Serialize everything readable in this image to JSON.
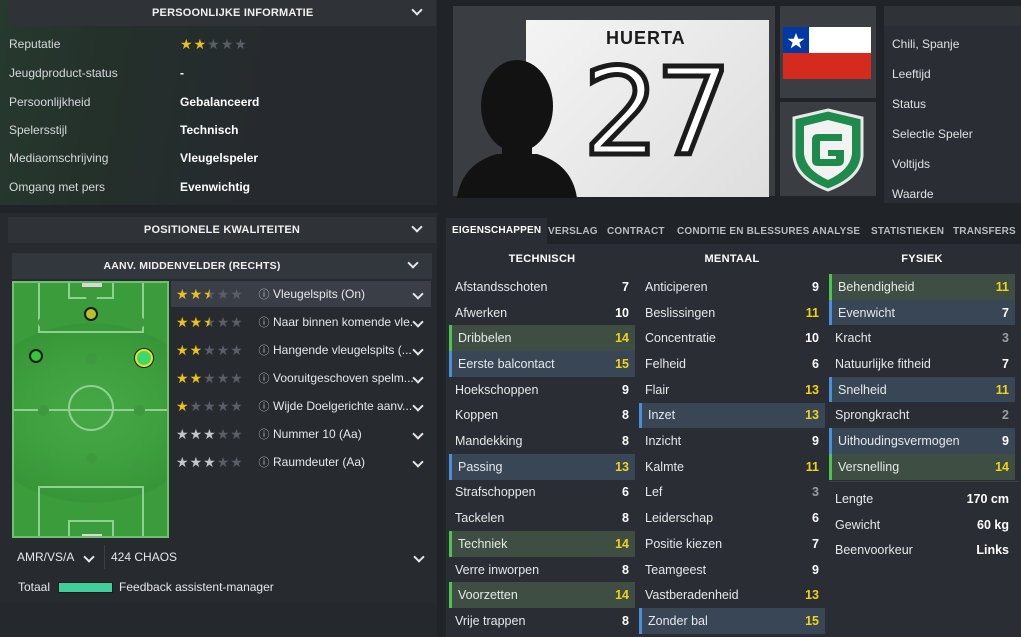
{
  "personal": {
    "header": "Persoonlijke informatie",
    "rows": [
      {
        "label": "Reputatie",
        "value": "",
        "stars": 2
      },
      {
        "label": "Jeugdproduct-status",
        "value": "-"
      },
      {
        "label": "Persoonlijkheid",
        "value": "Gebalanceerd"
      },
      {
        "label": "Spelersstijl",
        "value": "Technisch"
      },
      {
        "label": "Mediaomschrijving",
        "value": "Vleugelspeler"
      },
      {
        "label": "Omgang met pers",
        "value": "Evenwichtig"
      }
    ]
  },
  "positional": {
    "header": "Positionele kwaliteiten",
    "position_dropdown": "AANV. MIDDENVELDER (RECHTS)",
    "roles": [
      {
        "name": "Vleugelspits (On)",
        "stars": 2.5,
        "color": "gold"
      },
      {
        "name": "Naar binnen komende vle...",
        "stars": 2.5,
        "color": "gold"
      },
      {
        "name": "Hangende vleugelspits (...",
        "stars": 2,
        "color": "gold"
      },
      {
        "name": "Vooruitgeschoven spelm...",
        "stars": 2,
        "color": "gold"
      },
      {
        "name": "Wijde Doelgerichte aanv...",
        "stars": 1,
        "color": "gold"
      },
      {
        "name": "Nummer 10 (Aa)",
        "stars": 3,
        "color": "grey"
      },
      {
        "name": "Raumdeuter (Aa)",
        "stars": 3,
        "color": "grey"
      }
    ],
    "footer_left": "AMR/VS/A",
    "footer_right": "424 CHAOS",
    "total_label": "Totaal",
    "feedback_label": "Feedback assistent-manager"
  },
  "player": {
    "name": "HUERTA",
    "number": "27"
  },
  "right_info": [
    "Chili, Spanje",
    "Leeftijd",
    "Status",
    "Selectie Speler",
    "Voltijds",
    "Waarde"
  ],
  "tabs": [
    "Eigenschappen",
    "Verslag",
    "Contract",
    "Conditie en blessures",
    "Analyse",
    "Statistieken",
    "Transfers"
  ],
  "attributes": {
    "technical_header": "Technisch",
    "mental_header": "Mentaal",
    "physical_header": "Fysiek",
    "technical": [
      {
        "name": "Afstandsschoten",
        "value": "7",
        "hl": ""
      },
      {
        "name": "Afwerken",
        "value": "10",
        "hl": ""
      },
      {
        "name": "Dribbelen",
        "value": "14",
        "hl": "g"
      },
      {
        "name": "Eerste balcontact",
        "value": "15",
        "hl": "b"
      },
      {
        "name": "Hoekschoppen",
        "value": "9",
        "hl": ""
      },
      {
        "name": "Koppen",
        "value": "8",
        "hl": ""
      },
      {
        "name": "Mandekking",
        "value": "8",
        "hl": ""
      },
      {
        "name": "Passing",
        "value": "13",
        "hl": "b"
      },
      {
        "name": "Strafschoppen",
        "value": "6",
        "hl": ""
      },
      {
        "name": "Tackelen",
        "value": "8",
        "hl": ""
      },
      {
        "name": "Techniek",
        "value": "14",
        "hl": "g"
      },
      {
        "name": "Verre inworpen",
        "value": "8",
        "hl": ""
      },
      {
        "name": "Voorzetten",
        "value": "14",
        "hl": "g"
      },
      {
        "name": "Vrije trappen",
        "value": "8",
        "hl": ""
      }
    ],
    "mental": [
      {
        "name": "Anticiperen",
        "value": "9",
        "hl": ""
      },
      {
        "name": "Beslissingen",
        "value": "11",
        "hl": ""
      },
      {
        "name": "Concentratie",
        "value": "10",
        "hl": ""
      },
      {
        "name": "Felheid",
        "value": "6",
        "hl": ""
      },
      {
        "name": "Flair",
        "value": "13",
        "hl": ""
      },
      {
        "name": "Inzet",
        "value": "13",
        "hl": "b"
      },
      {
        "name": "Inzicht",
        "value": "9",
        "hl": ""
      },
      {
        "name": "Kalmte",
        "value": "11",
        "hl": ""
      },
      {
        "name": "Lef",
        "value": "3",
        "hl": ""
      },
      {
        "name": "Leiderschap",
        "value": "6",
        "hl": ""
      },
      {
        "name": "Positie kiezen",
        "value": "7",
        "hl": ""
      },
      {
        "name": "Teamgeest",
        "value": "9",
        "hl": ""
      },
      {
        "name": "Vastberadenheid",
        "value": "13",
        "hl": ""
      },
      {
        "name": "Zonder bal",
        "value": "15",
        "hl": "b"
      }
    ],
    "physical": [
      {
        "name": "Behendigheid",
        "value": "11",
        "hl": "g"
      },
      {
        "name": "Evenwicht",
        "value": "7",
        "hl": "b"
      },
      {
        "name": "Kracht",
        "value": "3",
        "hl": ""
      },
      {
        "name": "Natuurlijke fitheid",
        "value": "7",
        "hl": ""
      },
      {
        "name": "Snelheid",
        "value": "11",
        "hl": "b"
      },
      {
        "name": "Sprongkracht",
        "value": "2",
        "hl": ""
      },
      {
        "name": "Uithoudingsvermogen",
        "value": "9",
        "hl": "b"
      },
      {
        "name": "Versnelling",
        "value": "14",
        "hl": "g"
      }
    ],
    "bio": [
      {
        "label": "Lengte",
        "value": "170 cm"
      },
      {
        "label": "Gewicht",
        "value": "60 kg"
      },
      {
        "label": "Beenvoorkeur",
        "value": "Links"
      }
    ]
  },
  "colors": {
    "accent_green": "#4ec44e",
    "accent_blue": "#4a90d9",
    "yellow": "#f1d21b",
    "pitch": "#3a9c3a"
  }
}
